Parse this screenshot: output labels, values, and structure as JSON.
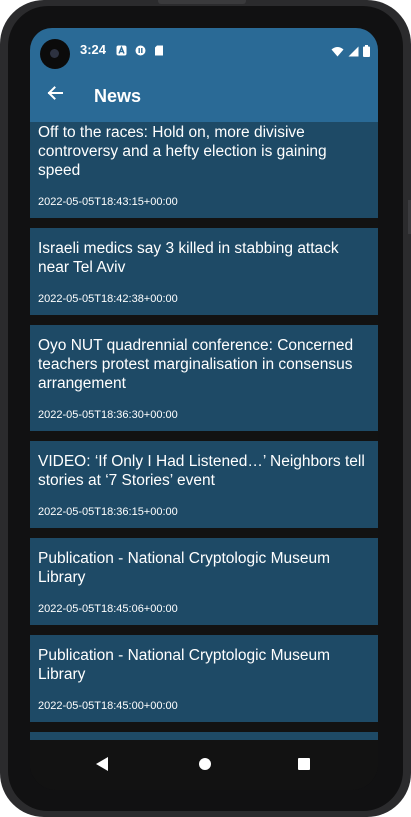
{
  "status_bar": {
    "time": "3:24",
    "notification_icons": [
      "a-icon",
      "pause-circle-icon",
      "sd-card-icon"
    ],
    "system_icons": [
      "wifi-icon",
      "signal-icon",
      "battery-icon"
    ]
  },
  "app_bar": {
    "title": "News",
    "back_icon": "arrow-left-icon"
  },
  "articles": [
    {
      "title": "Off to the races: Hold on, more divisive controversy and a hefty election is gaining speed",
      "date": "2022-05-05T18:43:15+00:00"
    },
    {
      "title": "Israeli medics say 3 killed in stabbing attack near Tel Aviv",
      "date": "2022-05-05T18:42:38+00:00"
    },
    {
      "title": "Oyo NUT quadrennial conference: Concerned teachers protest marginalisation in consensus arrangement",
      "date": "2022-05-05T18:36:30+00:00"
    },
    {
      "title": "VIDEO: ‘If Only I Had Listened…’ Neighbors tell stories at ‘7 Stories’ event",
      "date": "2022-05-05T18:36:15+00:00"
    },
    {
      "title": "Publication - National Cryptologic Museum Library",
      "date": "2022-05-05T18:45:06+00:00"
    },
    {
      "title": "Publication - National Cryptologic Museum Library",
      "date": "2022-05-05T18:45:00+00:00"
    }
  ],
  "nav_bar": {
    "buttons": [
      "back-triangle-icon",
      "home-circle-icon",
      "recents-square-icon"
    ]
  },
  "colors": {
    "app_bar": "#2a6a96",
    "card": "#1e4a66",
    "background": "#121212",
    "text": "#ffffff"
  }
}
